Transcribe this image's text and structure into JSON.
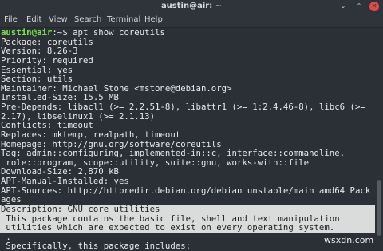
{
  "window": {
    "title": "austin@air: ~",
    "min_glyph": "⌄",
    "max_glyph": "⌃",
    "close_glyph": "✕"
  },
  "menu": {
    "items": [
      "File",
      "Edit",
      "View",
      "Search",
      "Terminal",
      "Help"
    ]
  },
  "terminal": {
    "prompt_user": "austin@air",
    "prompt_rest": ":~$ apt show coreutils",
    "lines": [
      "Package: coreutils",
      "Version: 8.26-3",
      "Priority: required",
      "Essential: yes",
      "Section: utils",
      "Maintainer: Michael Stone <mstone@debian.org>",
      "Installed-Size: 15.5 MB",
      "Pre-Depends: libacl1 (>= 2.2.51-8), libattr1 (>= 1:2.4.46-8), libc6 (>=",
      "2.17), libselinux1 (>= 2.1.13)",
      "Conflicts: timeout",
      "Replaces: mktemp, realpath, timeout",
      "Homepage: http://gnu.org/software/coreutils",
      "Tag: admin::configuring, implemented-in::c, interface::commandline,",
      " role::program, scope::utility, suite::gnu, works-with::file",
      "Download-Size: 2,870 kB",
      "APT-Manual-Installed: yes",
      "APT-Sources: http://httpredir.debian.org/debian unstable/main amd64 Pack",
      "ages"
    ],
    "highlighted_lines": [
      "Description: GNU core utilities",
      " This package contains the basic file, shell and text manipulation",
      " utilities which are expected to exist on every operating system."
    ],
    "tail_lines": [
      " .",
      " Specifically, this package includes:"
    ]
  },
  "watermark": "wsxdn.com",
  "colors": {
    "background": "#2b3036",
    "prompt_user": "#7ee34b",
    "highlight_bg": "#dadcdc",
    "close_button": "#e14a4a"
  }
}
